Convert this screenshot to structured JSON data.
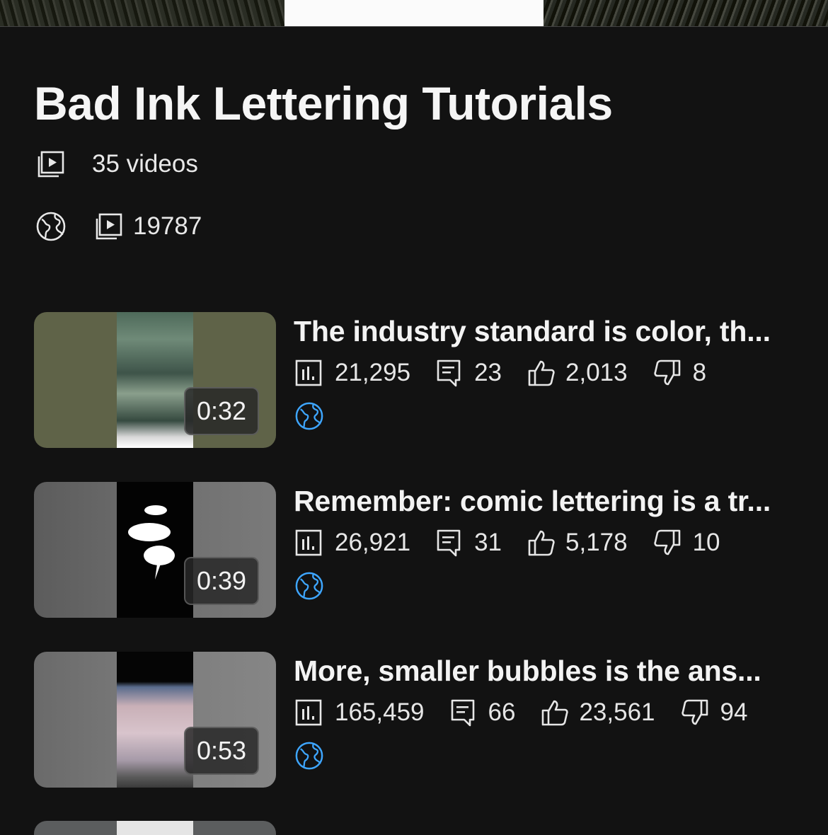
{
  "playlist": {
    "title": "Bad Ink Lettering Tutorials",
    "video_count": "35 videos",
    "views_total": "19787"
  },
  "icons": {
    "playlist": "playlist-play-icon",
    "globe": "globe-icon",
    "views": "bar-chart-icon",
    "comments": "comment-icon",
    "likes": "thumbs-up-icon",
    "dislikes": "thumbs-down-icon"
  },
  "colors": {
    "background": "#121212",
    "accent_blue": "#3ea6ff"
  },
  "videos": [
    {
      "title": "The industry standard is color, th...",
      "duration": "0:32",
      "views": "21,295",
      "comments": "23",
      "likes": "2,013",
      "dislikes": "8"
    },
    {
      "title": "Remember: comic lettering is a tr...",
      "duration": "0:39",
      "views": "26,921",
      "comments": "31",
      "likes": "5,178",
      "dislikes": "10"
    },
    {
      "title": "More, smaller bubbles is the ans...",
      "duration": "0:53",
      "views": "165,459",
      "comments": "66",
      "likes": "23,561",
      "dislikes": "94"
    }
  ]
}
